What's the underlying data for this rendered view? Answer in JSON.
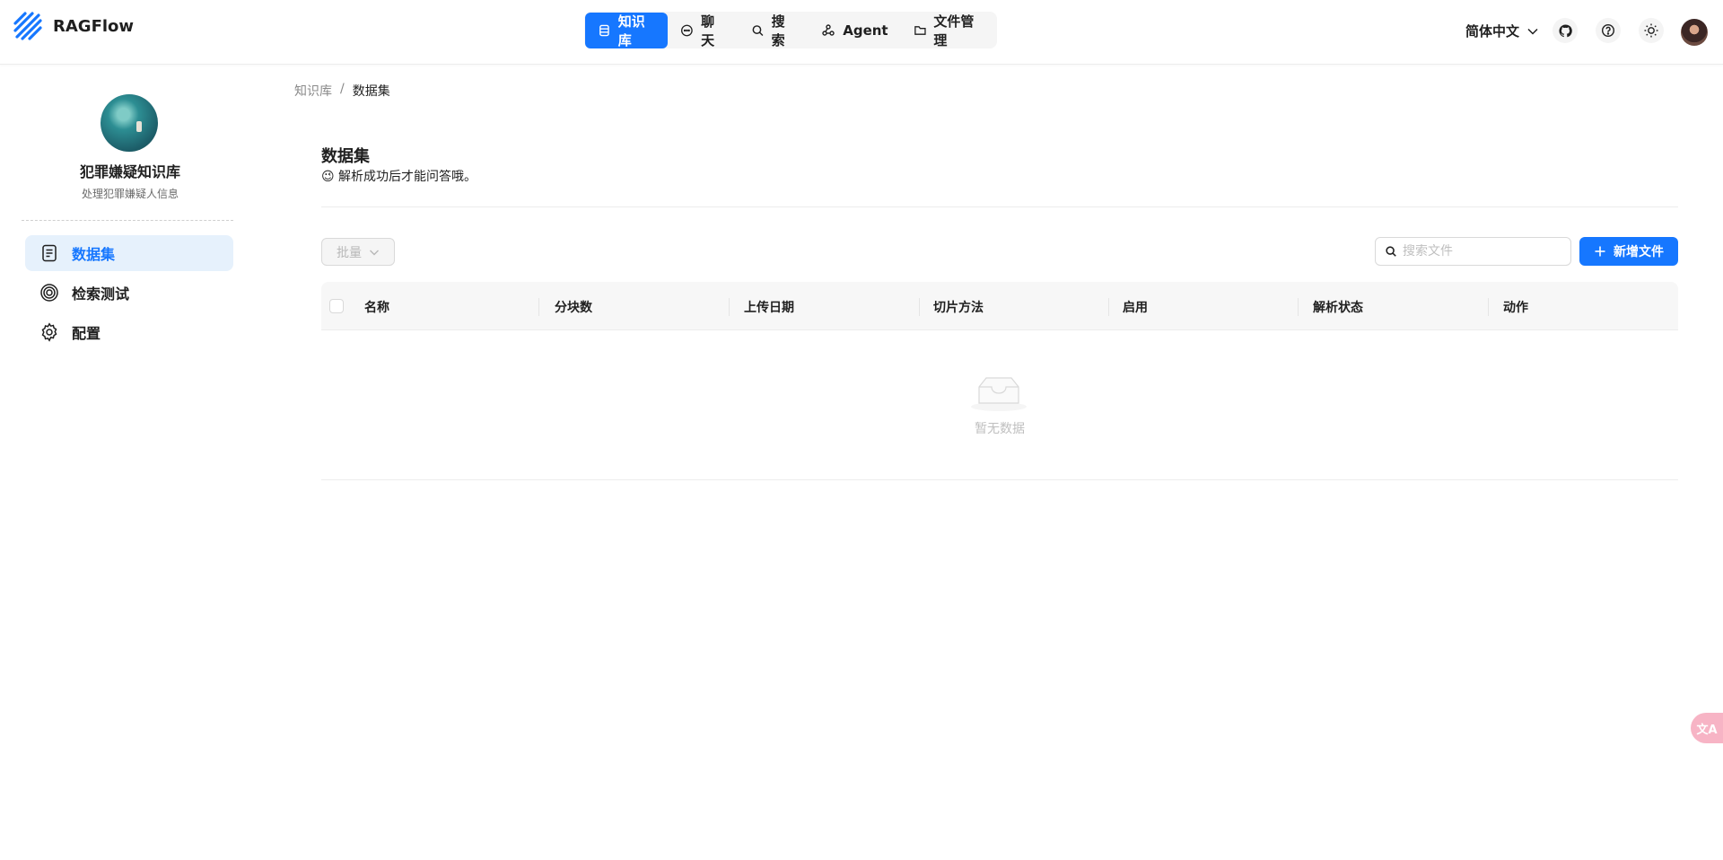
{
  "app": {
    "brand": "RAGFlow"
  },
  "nav": {
    "items": [
      {
        "label": "知识库",
        "icon": "database-icon",
        "active": true
      },
      {
        "label": "聊天",
        "icon": "chat-icon",
        "active": false
      },
      {
        "label": "搜索",
        "icon": "search-icon",
        "active": false
      },
      {
        "label": "Agent",
        "icon": "agent-icon",
        "active": false
      },
      {
        "label": "文件管理",
        "icon": "folder-icon",
        "active": false
      }
    ]
  },
  "header_right": {
    "language": "简体中文",
    "icons": [
      "github-icon",
      "help-icon",
      "theme-sun-icon"
    ]
  },
  "sidebar": {
    "kb_name": "犯罪嫌疑知识库",
    "kb_description": "处理犯罪嫌疑人信息",
    "items": [
      {
        "label": "数据集",
        "icon": "document-icon",
        "active": true
      },
      {
        "label": "检索测试",
        "icon": "target-icon",
        "active": false
      },
      {
        "label": "配置",
        "icon": "gear-icon",
        "active": false
      }
    ]
  },
  "breadcrumb": {
    "root": "知识库",
    "separator": "/",
    "current": "数据集"
  },
  "main": {
    "title": "数据集",
    "tip": "😉 解析成功后才能问答哦。",
    "bulk_label": "批量",
    "search_placeholder": "搜索文件",
    "add_label": "新增文件",
    "columns": [
      "名称",
      "分块数",
      "上传日期",
      "切片方法",
      "启用",
      "解析状态",
      "动作"
    ],
    "rows": [],
    "empty_text": "暂无数据"
  },
  "colors": {
    "primary": "#1677ff",
    "active_bg": "#e6f1fc",
    "float_widget": "#f7b4c5"
  }
}
